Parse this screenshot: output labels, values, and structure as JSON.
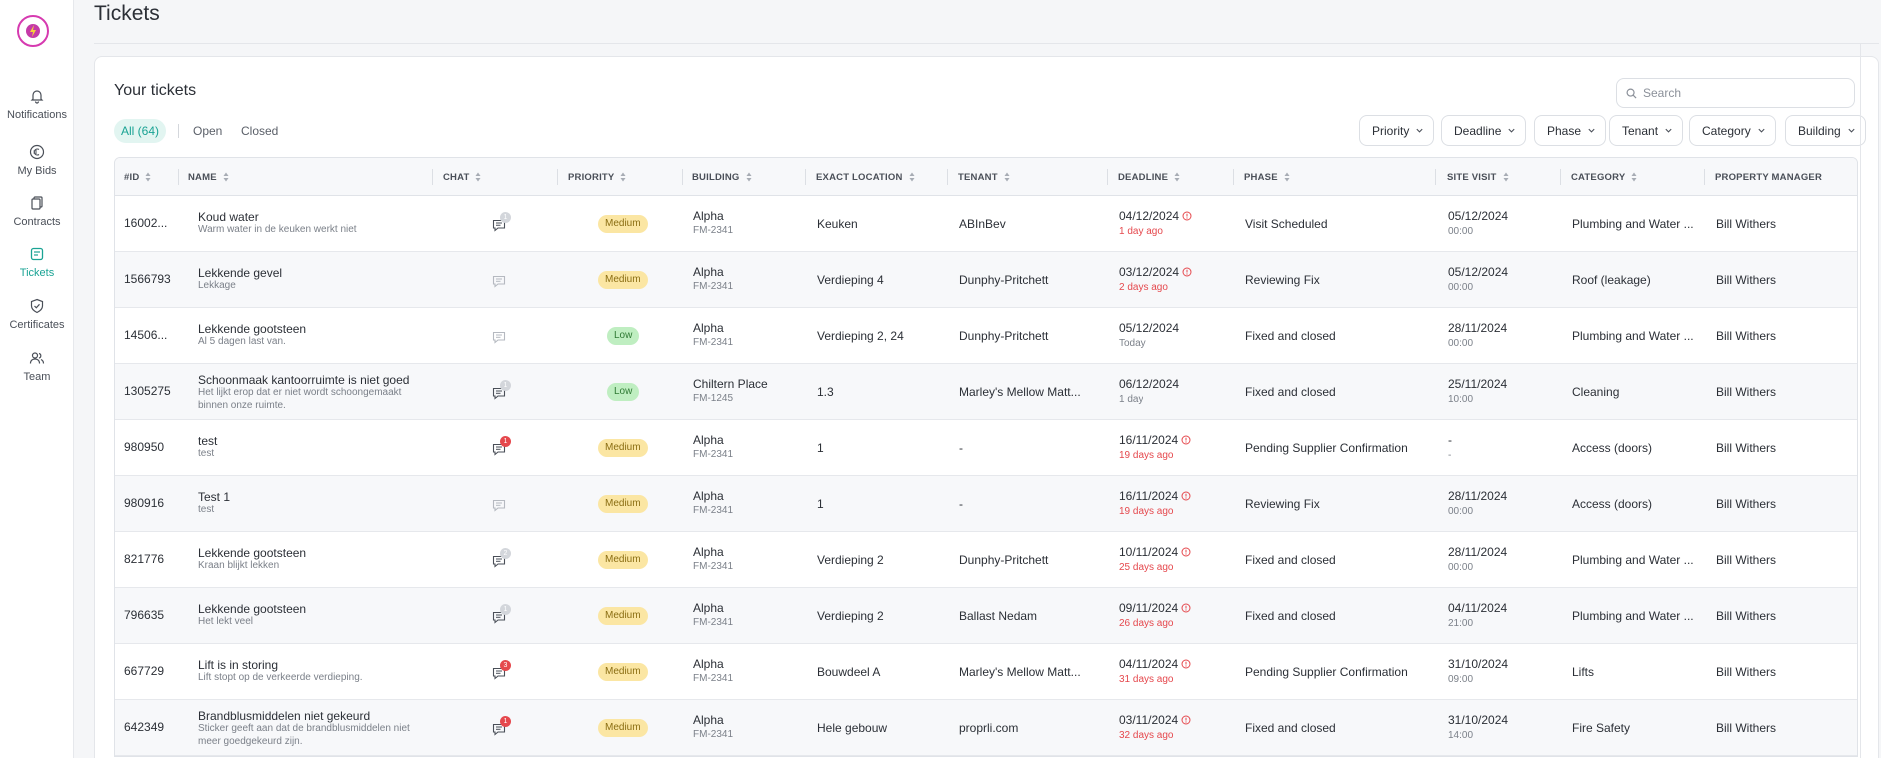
{
  "sidebar": {
    "items": [
      {
        "label": "Notifications",
        "icon": "bell-icon"
      },
      {
        "label": "My Bids",
        "icon": "euro-circle-icon"
      },
      {
        "label": "Contracts",
        "icon": "documents-icon"
      },
      {
        "label": "Tickets",
        "icon": "ticket-icon",
        "active": true
      },
      {
        "label": "Certificates",
        "icon": "shield-check-icon"
      },
      {
        "label": "Team",
        "icon": "team-icon"
      }
    ]
  },
  "page": {
    "title": "Tickets"
  },
  "card": {
    "title": "Your tickets"
  },
  "search": {
    "placeholder": "Search"
  },
  "tabs": {
    "all": "All (64)",
    "open": "Open",
    "closed": "Closed"
  },
  "filters": [
    "Priority",
    "Deadline",
    "Phase",
    "Tenant",
    "Category",
    "Building"
  ],
  "columns": [
    "#ID",
    "NAME",
    "CHAT",
    "PRIORITY",
    "BUILDING",
    "EXACT LOCATION",
    "TENANT",
    "DEADLINE",
    "PHASE",
    "SITE VISIT",
    "CATEGORY",
    "PROPERTY MANAGER"
  ],
  "colors": {
    "accent": "#1aa394",
    "danger": "#e5484d",
    "medium": "#fbe6a3",
    "low": "#bfeec1"
  },
  "rows": [
    {
      "id": "16002...",
      "name": "Koud water",
      "desc": "Warm water in de keuken werkt niet",
      "chat": "1",
      "chat_style": "grey",
      "priority": "Medium",
      "building": "Alpha",
      "building_code": "FM-2341",
      "location": "Keuken",
      "tenant": "ABInBev",
      "deadline": "04/12/2024",
      "deadline_note": "1 day ago",
      "overdue": true,
      "phase": "Visit Scheduled",
      "site_visit": "05/12/2024",
      "site_visit_time": "00:00",
      "category": "Plumbing and Water ...",
      "manager": "Bill Withers"
    },
    {
      "id": "1566793",
      "name": "Lekkende gevel",
      "desc": "Lekkage",
      "chat": "",
      "chat_style": "none",
      "priority": "Medium",
      "building": "Alpha",
      "building_code": "FM-2341",
      "location": "Verdieping 4",
      "tenant": "Dunphy-Pritchett",
      "deadline": "03/12/2024",
      "deadline_note": "2 days ago",
      "overdue": true,
      "phase": "Reviewing Fix",
      "site_visit": "05/12/2024",
      "site_visit_time": "00:00",
      "category": "Roof (leakage)",
      "manager": "Bill Withers"
    },
    {
      "id": "14506...",
      "name": "Lekkende gootsteen",
      "desc": "Al 5 dagen last van.",
      "chat": "",
      "chat_style": "none",
      "priority": "Low",
      "building": "Alpha",
      "building_code": "FM-2341",
      "location": "Verdieping 2, 24",
      "tenant": "Dunphy-Pritchett",
      "deadline": "05/12/2024",
      "deadline_note": "Today",
      "overdue": false,
      "phase": "Fixed and closed",
      "site_visit": "28/11/2024",
      "site_visit_time": "00:00",
      "category": "Plumbing and Water ...",
      "manager": "Bill Withers"
    },
    {
      "id": "1305275",
      "name": "Schoonmaak kantoorruimte is niet goed",
      "desc": "Het lijkt erop dat er niet wordt schoongemaakt",
      "desc2": "binnen onze ruimte.",
      "chat": "1",
      "chat_style": "grey",
      "priority": "Low",
      "building": "Chiltern Place",
      "building_code": "FM-1245",
      "location": "1.3",
      "tenant": "Marley's Mellow Matt...",
      "deadline": "06/12/2024",
      "deadline_note": "1 day",
      "overdue": false,
      "phase": "Fixed and closed",
      "site_visit": "25/11/2024",
      "site_visit_time": "10:00",
      "category": "Cleaning",
      "manager": "Bill Withers"
    },
    {
      "id": "980950",
      "name": "test",
      "desc": "test",
      "chat": "1",
      "chat_style": "red",
      "priority": "Medium",
      "building": "Alpha",
      "building_code": "FM-2341",
      "location": "1",
      "tenant": "-",
      "deadline": "16/11/2024",
      "deadline_note": "19 days ago",
      "overdue": true,
      "phase": "Pending Supplier Confirmation",
      "site_visit": "-",
      "site_visit_time": "-",
      "category": "Access (doors)",
      "manager": "Bill Withers"
    },
    {
      "id": "980916",
      "name": "Test 1",
      "desc": "test",
      "chat": "",
      "chat_style": "none",
      "priority": "Medium",
      "building": "Alpha",
      "building_code": "FM-2341",
      "location": "1",
      "tenant": "-",
      "deadline": "16/11/2024",
      "deadline_note": "19 days ago",
      "overdue": true,
      "phase": "Reviewing Fix",
      "site_visit": "28/11/2024",
      "site_visit_time": "00:00",
      "category": "Access (doors)",
      "manager": "Bill Withers"
    },
    {
      "id": "821776",
      "name": "Lekkende gootsteen",
      "desc": "Kraan blijkt lekken",
      "chat": "2",
      "chat_style": "grey",
      "priority": "Medium",
      "building": "Alpha",
      "building_code": "FM-2341",
      "location": "Verdieping 2",
      "tenant": "Dunphy-Pritchett",
      "deadline": "10/11/2024",
      "deadline_note": "25 days ago",
      "overdue": true,
      "phase": "Fixed and closed",
      "site_visit": "28/11/2024",
      "site_visit_time": "00:00",
      "category": "Plumbing and Water ...",
      "manager": "Bill Withers"
    },
    {
      "id": "796635",
      "name": "Lekkende gootsteen",
      "desc": "Het lekt veel",
      "chat": "1",
      "chat_style": "grey",
      "priority": "Medium",
      "building": "Alpha",
      "building_code": "FM-2341",
      "location": "Verdieping 2",
      "tenant": "Ballast Nedam",
      "deadline": "09/11/2024",
      "deadline_note": "26 days ago",
      "overdue": true,
      "phase": "Fixed and closed",
      "site_visit": "04/11/2024",
      "site_visit_time": "21:00",
      "category": "Plumbing and Water ...",
      "manager": "Bill Withers"
    },
    {
      "id": "667729",
      "name": "Lift is in storing",
      "desc": "Lift stopt op de verkeerde verdieping.",
      "chat": "3",
      "chat_style": "red",
      "priority": "Medium",
      "building": "Alpha",
      "building_code": "FM-2341",
      "location": "Bouwdeel A",
      "tenant": "Marley's Mellow Matt...",
      "deadline": "04/11/2024",
      "deadline_note": "31 days ago",
      "overdue": true,
      "phase": "Pending Supplier Confirmation",
      "site_visit": "31/10/2024",
      "site_visit_time": "09:00",
      "category": "Lifts",
      "manager": "Bill Withers"
    },
    {
      "id": "642349",
      "name": "Brandblusmiddelen niet gekeurd",
      "desc": "Sticker geeft aan dat de brandblusmiddelen niet",
      "desc2": "meer goedgekeurd zijn.",
      "chat": "1",
      "chat_style": "red",
      "priority": "Medium",
      "building": "Alpha",
      "building_code": "FM-2341",
      "location": "Hele gebouw",
      "tenant": "proprli.com",
      "deadline": "03/11/2024",
      "deadline_note": "32 days ago",
      "overdue": true,
      "phase": "Fixed and closed",
      "site_visit": "31/10/2024",
      "site_visit_time": "14:00",
      "category": "Fire Safety",
      "manager": "Bill Withers"
    }
  ]
}
